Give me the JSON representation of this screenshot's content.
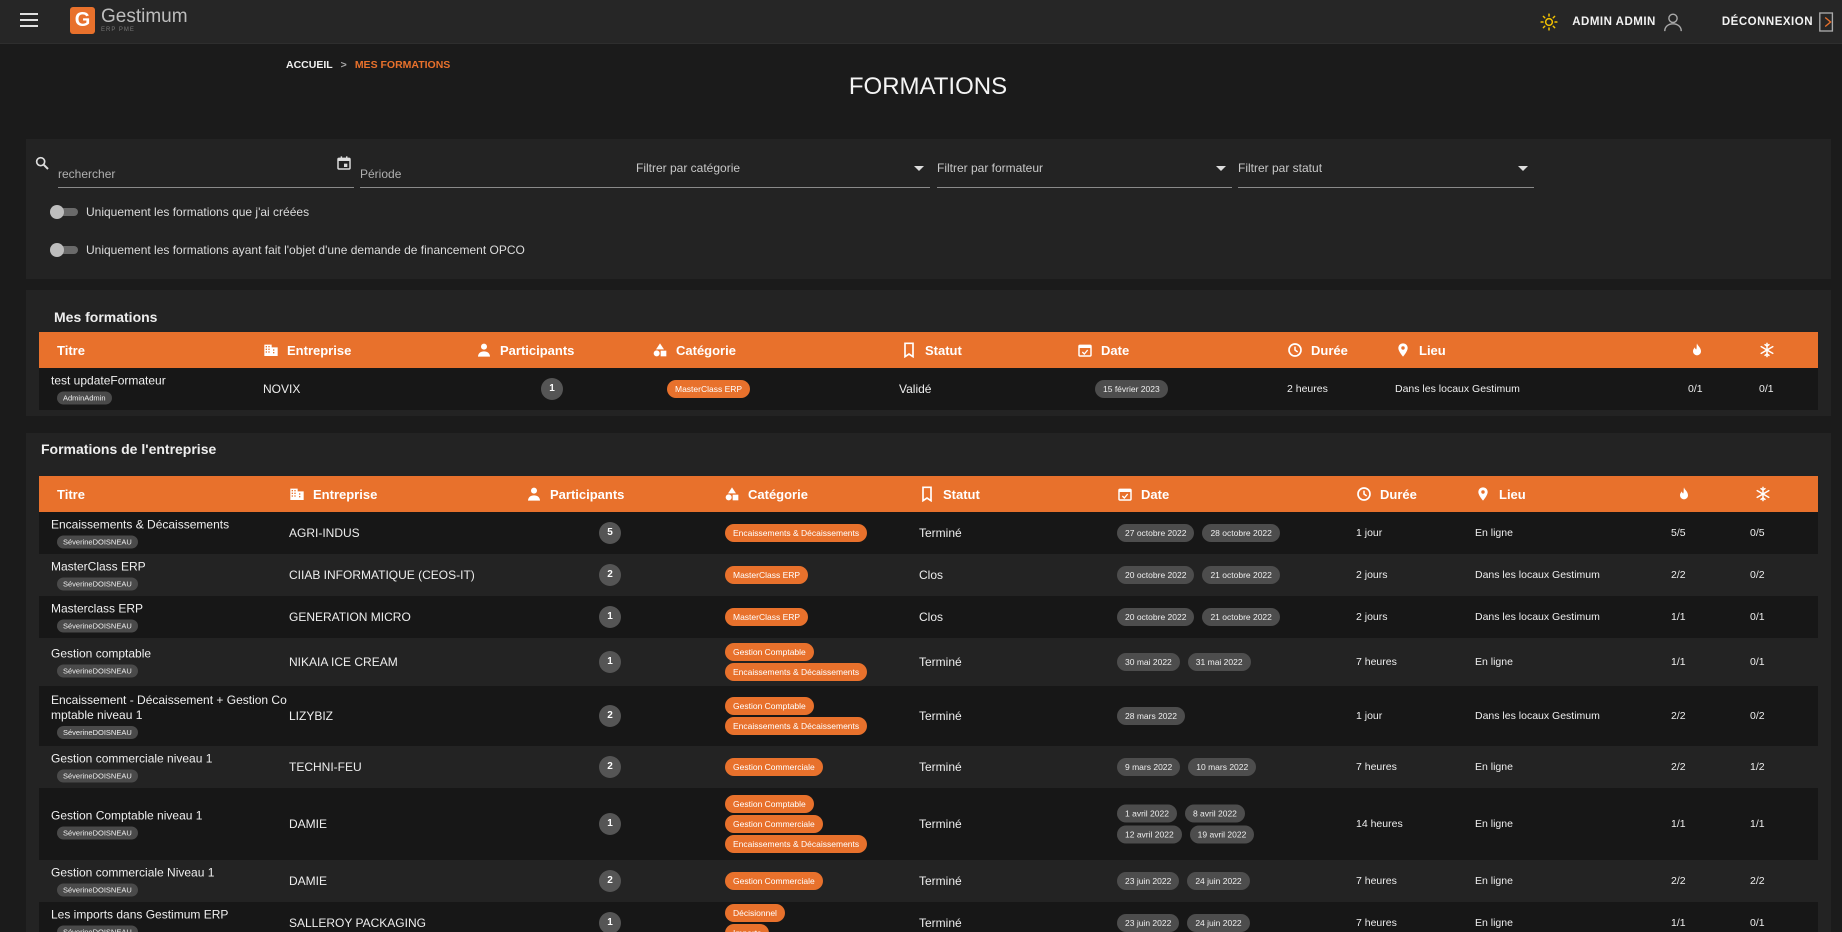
{
  "app": {
    "name": "Gestimum",
    "tagline": "ERP PME"
  },
  "header": {
    "user": "ADMIN ADMIN",
    "logout": "DÉCONNEXION"
  },
  "breadcrumb": {
    "home": "ACCUEIL",
    "separator": ">",
    "current": "MES FORMATIONS"
  },
  "page_title": "FORMATIONS",
  "filters": {
    "search_placeholder": "rechercher",
    "period_placeholder": "Période",
    "category_label": "Filtrer par catégorie",
    "trainer_label": "Filtrer par formateur",
    "status_label": "Filtrer par statut",
    "toggle_mine": "Uniquement les formations que j'ai créées",
    "toggle_opco": "Uniquement les formations ayant fait l'objet d'une demande de financement OPCO"
  },
  "columns": {
    "titre": "Titre",
    "entreprise": "Entreprise",
    "participants": "Participants",
    "categorie": "Catégorie",
    "statut": "Statut",
    "date": "Date",
    "duree": "Durée",
    "lieu": "Lieu"
  },
  "mes_formations": {
    "title": "Mes formations",
    "rows": [
      {
        "titre": "test updateFormateur",
        "author": "AdminAdmin",
        "entreprise": "NOVIX",
        "participants": "1",
        "categories": [
          "MasterClass ERP"
        ],
        "statut": "Validé",
        "dates": [
          "15 février 2023"
        ],
        "duree": "2 heures",
        "lieu": "Dans les locaux Gestimum",
        "ratio1": "0/1",
        "ratio2": "0/1"
      }
    ]
  },
  "formations_entreprise": {
    "title": "Formations de l'entreprise",
    "rows": [
      {
        "titre": "Encaissements & Décaissements",
        "author": "SéverineDOISNEAU",
        "entreprise": "AGRI-INDUS",
        "participants": "5",
        "categories": [
          "Encaissements & Décaissements"
        ],
        "statut": "Terminé",
        "dates": [
          "27 octobre 2022",
          "28 octobre 2022"
        ],
        "duree": "1 jour",
        "lieu": "En ligne",
        "ratio1": "5/5",
        "ratio2": "0/5"
      },
      {
        "titre": "MasterClass ERP",
        "author": "SéverineDOISNEAU",
        "entreprise": "CIIAB INFORMATIQUE (CEOS-IT)",
        "participants": "2",
        "categories": [
          "MasterClass ERP"
        ],
        "statut": "Clos",
        "dates": [
          "20 octobre 2022",
          "21 octobre 2022"
        ],
        "duree": "2 jours",
        "lieu": "Dans les locaux Gestimum",
        "ratio1": "2/2",
        "ratio2": "0/2"
      },
      {
        "titre": "Masterclass ERP",
        "author": "SéverineDOISNEAU",
        "entreprise": "GENERATION MICRO",
        "participants": "1",
        "categories": [
          "MasterClass ERP"
        ],
        "statut": "Clos",
        "dates": [
          "20 octobre 2022",
          "21 octobre 2022"
        ],
        "duree": "2 jours",
        "lieu": "Dans les locaux Gestimum",
        "ratio1": "1/1",
        "ratio2": "0/1"
      },
      {
        "titre": "Gestion comptable",
        "author": "SéverineDOISNEAU",
        "entreprise": "NIKAIA ICE CREAM",
        "participants": "1",
        "categories": [
          "Gestion Comptable",
          "Encaissements & Décaissements"
        ],
        "statut": "Terminé",
        "dates": [
          "30 mai 2022",
          "31 mai 2022"
        ],
        "duree": "7 heures",
        "lieu": "En ligne",
        "ratio1": "1/1",
        "ratio2": "0/1"
      },
      {
        "titre": "Encaissement - Décaissement + Gestion Co mptable niveau 1",
        "title_line1": "Encaissement - Décaissement + Gestion Co",
        "title_line2": "mptable niveau 1",
        "author": "SéverineDOISNEAU",
        "entreprise": "LIZYBIZ",
        "participants": "2",
        "categories": [
          "Gestion Comptable",
          "Encaissements & Décaissements"
        ],
        "statut": "Terminé",
        "dates": [
          "28 mars 2022"
        ],
        "duree": "1 jour",
        "lieu": "Dans les locaux Gestimum",
        "ratio1": "2/2",
        "ratio2": "0/2"
      },
      {
        "titre": "Gestion commerciale niveau 1",
        "author": "SéverineDOISNEAU",
        "entreprise": "TECHNI-FEU",
        "participants": "2",
        "categories": [
          "Gestion Commerciale"
        ],
        "statut": "Terminé",
        "dates": [
          "9 mars 2022",
          "10 mars 2022"
        ],
        "duree": "7 heures",
        "lieu": "En ligne",
        "ratio1": "2/2",
        "ratio2": "1/2"
      },
      {
        "titre": "Gestion Comptable niveau 1",
        "author": "SéverineDOISNEAU",
        "entreprise": "DAMIE",
        "participants": "1",
        "categories": [
          "Gestion Comptable",
          "Gestion Commerciale",
          "Encaissements & Décaissements"
        ],
        "statut": "Terminé",
        "dates": [
          "1 avril 2022",
          "8 avril 2022",
          "12 avril 2022",
          "19 avril 2022"
        ],
        "duree": "14 heures",
        "lieu": "En ligne",
        "ratio1": "1/1",
        "ratio2": "1/1"
      },
      {
        "titre": "Gestion commerciale Niveau 1",
        "author": "SéverineDOISNEAU",
        "entreprise": "DAMIE",
        "participants": "2",
        "categories": [
          "Gestion Commerciale"
        ],
        "statut": "Terminé",
        "dates": [
          "23 juin 2022",
          "24 juin 2022"
        ],
        "duree": "7 heures",
        "lieu": "En ligne",
        "ratio1": "2/2",
        "ratio2": "2/2"
      },
      {
        "titre": "Les imports dans Gestimum ERP",
        "author": "SéverineDOISNEAU",
        "entreprise": "SALLEROY PACKAGING",
        "participants": "1",
        "categories": [
          "Décisionnel",
          "Imports"
        ],
        "statut": "Terminé",
        "dates": [
          "23 juin 2022",
          "24 juin 2022"
        ],
        "duree": "7 heures",
        "lieu": "En ligne",
        "ratio1": "1/1",
        "ratio2": "0/1"
      }
    ]
  },
  "colors": {
    "accent": "#e8712c",
    "background": "#1b1b1b",
    "panel": "#232323",
    "chip_grey": "#4d4d4d"
  },
  "icons": [
    "menu-icon",
    "sun-icon",
    "user-icon",
    "logout-icon",
    "search-icon",
    "calendar-icon",
    "building-icon",
    "person-icon",
    "shapes-icon",
    "bookmark-icon",
    "clock-icon",
    "location-icon",
    "flame-icon",
    "snowflake-icon"
  ]
}
